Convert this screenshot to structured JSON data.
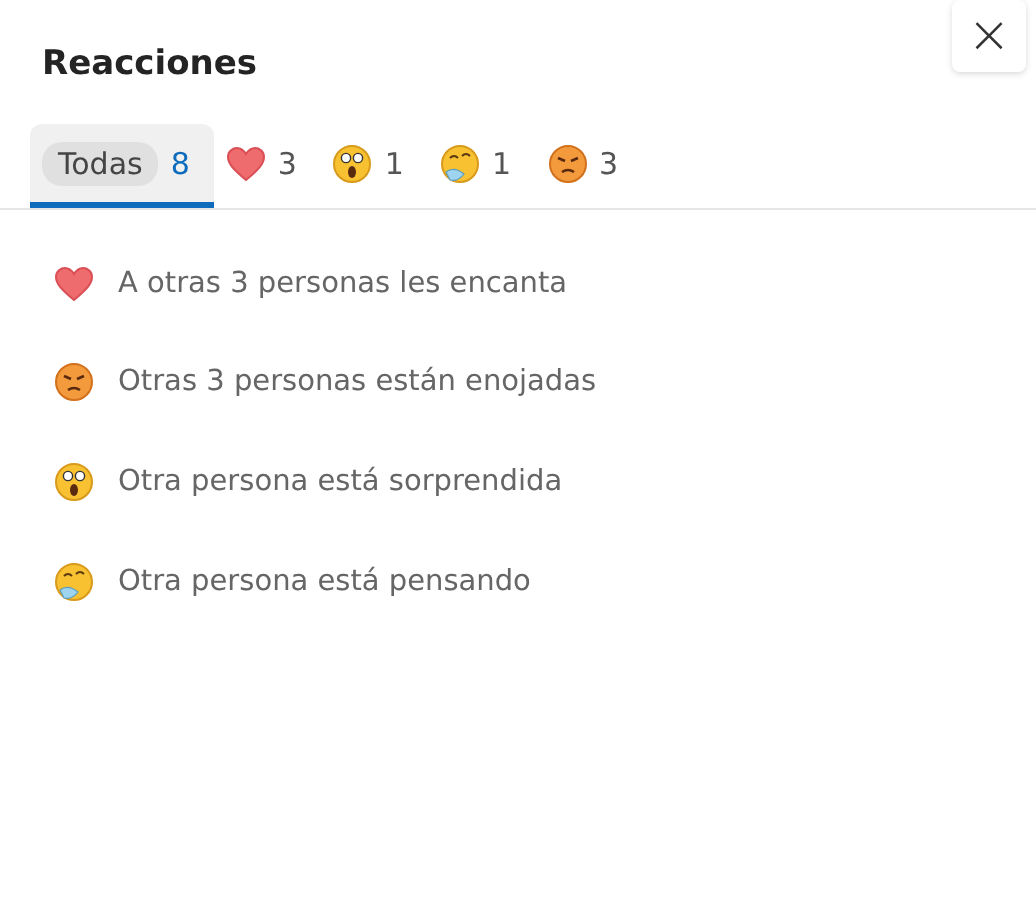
{
  "title": "Reacciones",
  "close": "×",
  "tabs": [
    {
      "kind": "all",
      "label": "Todas",
      "count": "8",
      "selected": true
    },
    {
      "kind": "heart",
      "count": "3",
      "selected": false
    },
    {
      "kind": "surprised",
      "count": "1",
      "selected": false
    },
    {
      "kind": "thinking",
      "count": "1",
      "selected": false
    },
    {
      "kind": "angry",
      "count": "3",
      "selected": false
    }
  ],
  "reactions": [
    {
      "kind": "heart",
      "text": "A otras 3 personas les encanta"
    },
    {
      "kind": "angry",
      "text": "Otras 3 personas están enojadas"
    },
    {
      "kind": "surprised",
      "text": "Otra persona está sorprendida"
    },
    {
      "kind": "thinking",
      "text": "Otra persona está pensando"
    }
  ]
}
